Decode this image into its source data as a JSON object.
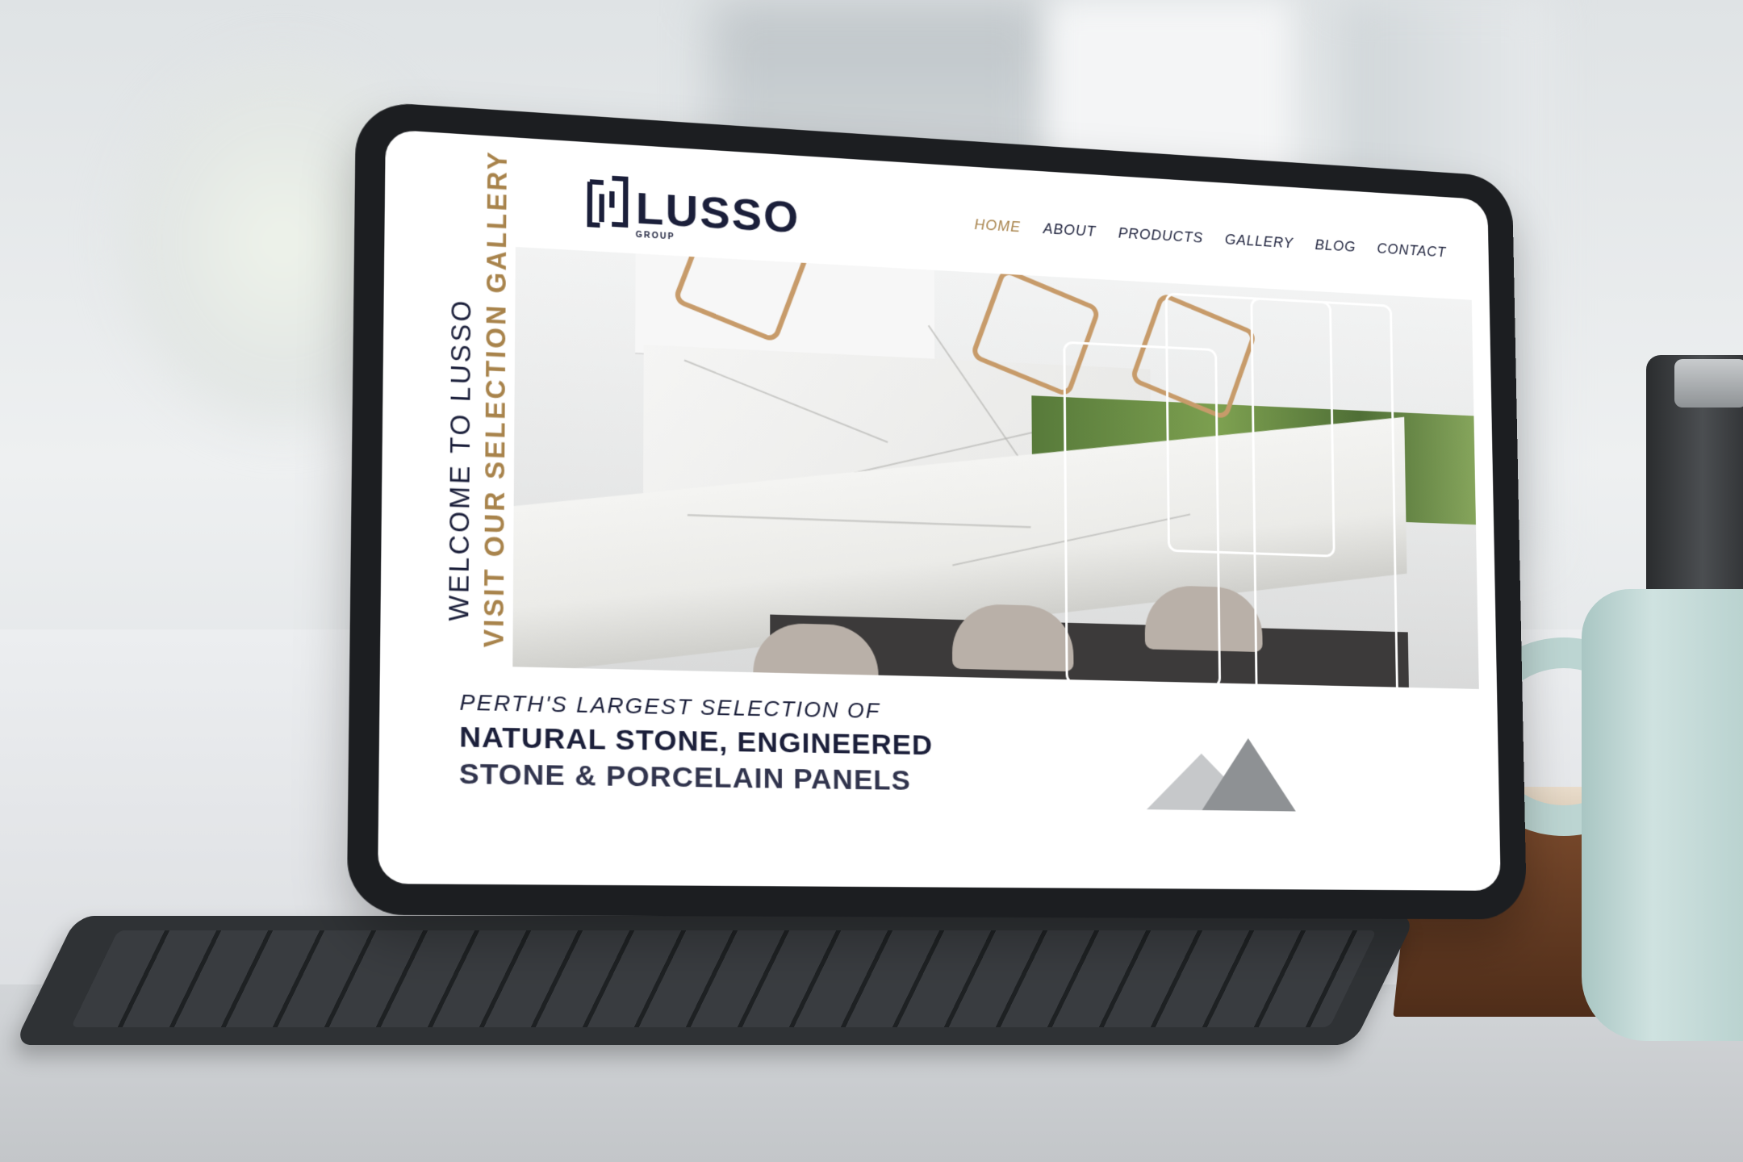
{
  "site": {
    "logo": {
      "word": "LUSSO",
      "sub": "GROUP"
    },
    "nav": [
      {
        "label": "HOME",
        "active": true
      },
      {
        "label": "ABOUT",
        "active": false
      },
      {
        "label": "PRODUCTS",
        "active": false
      },
      {
        "label": "GALLERY",
        "active": false
      },
      {
        "label": "BLOG",
        "active": false
      },
      {
        "label": "CONTACT",
        "active": false
      }
    ],
    "side_text": {
      "welcome": "WELCOME TO LUSSO",
      "visit": "VISIT OUR SELECTION GALLERY"
    },
    "tagline": {
      "line1": "PERTH'S LARGEST SELECTION OF",
      "line2": "NATURAL STONE, ENGINEERED",
      "line3": "STONE & PORCELAIN PANELS"
    },
    "colors": {
      "navy": "#1b1f3a",
      "gold": "#a8834b"
    }
  }
}
